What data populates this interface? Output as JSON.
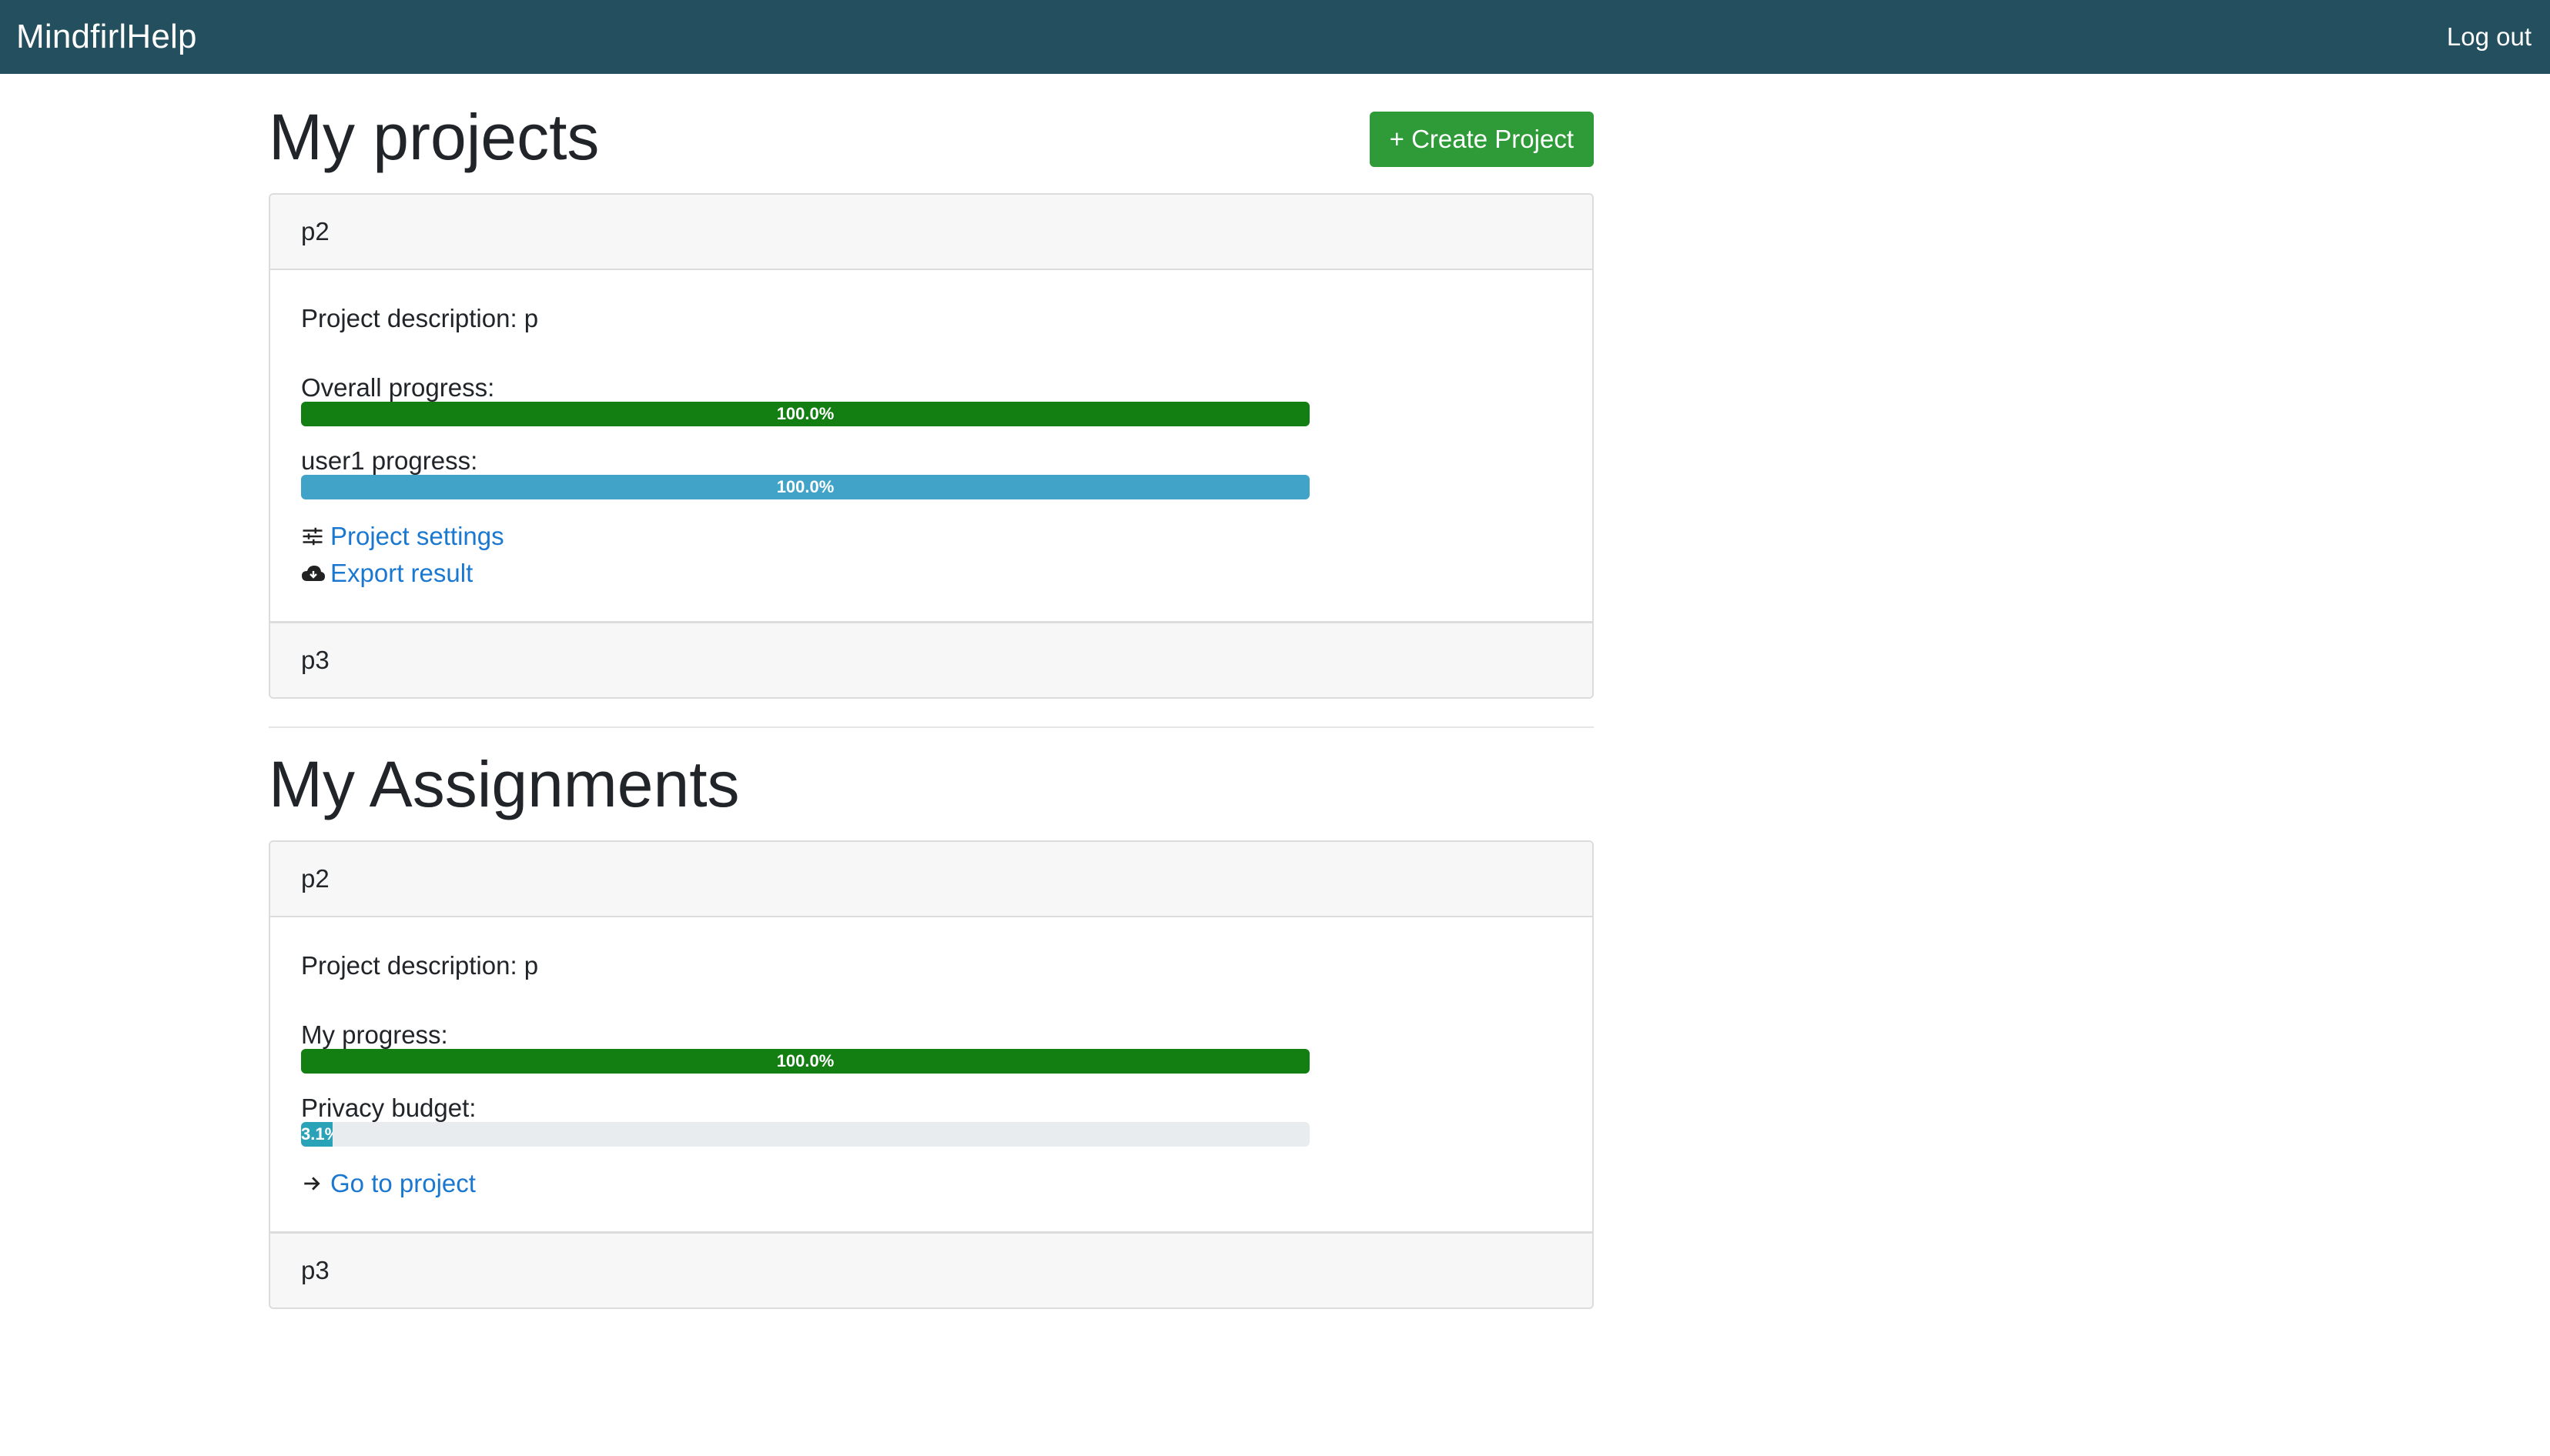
{
  "app": {
    "brand": "MindfirlHelp",
    "logout_label": "Log out"
  },
  "projects": {
    "title": "My projects",
    "create_button": "+ Create Project",
    "items": [
      {
        "name": "p2",
        "description": "Project description: p",
        "progress": [
          {
            "label": "Overall progress:",
            "value": 1.0,
            "text": "100.0%",
            "color": "#137e12"
          },
          {
            "label": "user1 progress:",
            "value": 1.0,
            "text": "100.0%",
            "color": "#41a3c7"
          }
        ],
        "links": [
          {
            "icon": "sliders-icon",
            "label": "Project settings"
          },
          {
            "icon": "cloud-download-icon",
            "label": "Export result"
          }
        ]
      },
      {
        "name": "p3"
      }
    ]
  },
  "assignments": {
    "title": "My Assignments",
    "items": [
      {
        "name": "p2",
        "description": "Project description: p",
        "progress": [
          {
            "label": "My progress:",
            "value": 1.0,
            "text": "100.0%",
            "color": "#137e12"
          },
          {
            "label": "Privacy budget:",
            "value": 0.031,
            "text": "3.1%",
            "color": "#2aa3b9"
          }
        ],
        "links": [
          {
            "icon": "arrow-right-icon",
            "label": "Go to project"
          }
        ]
      },
      {
        "name": "p3"
      }
    ]
  }
}
